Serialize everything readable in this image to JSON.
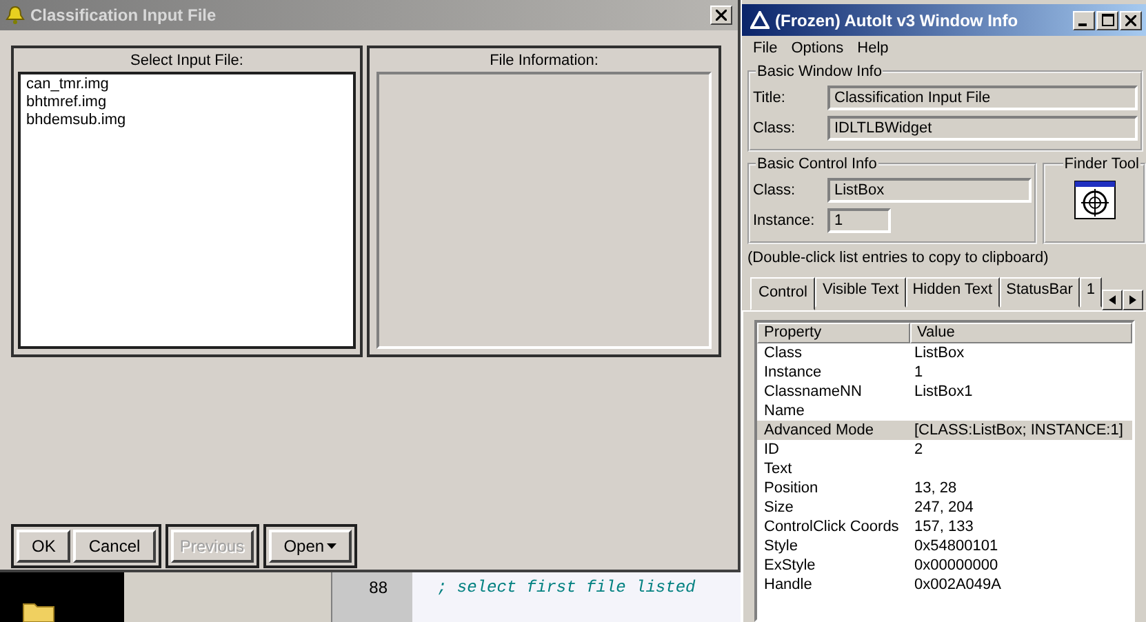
{
  "dialog": {
    "title": "Classification Input File",
    "select_panel": {
      "heading": "Select Input File:",
      "files": [
        {
          "name": "can_tmr.img",
          "selected": false
        },
        {
          "name": "bhtmref.img",
          "selected": false
        },
        {
          "name": "bhdemsub.img",
          "selected": false
        }
      ]
    },
    "info_panel": {
      "heading": "File Information:"
    },
    "button_groups": [
      [
        {
          "label": "OK",
          "disabled": false,
          "kind": "plain"
        },
        {
          "label": "Cancel",
          "disabled": false,
          "kind": "plain"
        }
      ],
      [
        {
          "label": "Previous",
          "disabled": true,
          "kind": "plain"
        }
      ],
      [
        {
          "label": "Open",
          "disabled": false,
          "kind": "menu"
        }
      ]
    ]
  },
  "editor": {
    "line_number": "88",
    "code": "; select first file listed"
  },
  "info_window": {
    "title": "(Frozen) AutoIt v3 Window Info",
    "menu": [
      "File",
      "Options",
      "Help"
    ],
    "window_info": {
      "heading": "Basic Window Info",
      "fields": [
        {
          "label": "Title:",
          "value": "Classification Input File"
        },
        {
          "label": "Class:",
          "value": "IDLTLBWidget"
        }
      ]
    },
    "control_info": {
      "heading": "Basic Control Info",
      "fields": [
        {
          "label": "Class:",
          "value": "ListBox"
        },
        {
          "label": "Instance:",
          "value": "1"
        }
      ]
    },
    "finder": {
      "heading": "Finder Tool"
    },
    "hint": "(Double-click list entries to copy to clipboard)",
    "tabs": [
      {
        "label": "Control",
        "selected": true
      },
      {
        "label": "Visible Text",
        "selected": false
      },
      {
        "label": "Hidden Text",
        "selected": false
      },
      {
        "label": "StatusBar",
        "selected": false
      },
      {
        "label": "1",
        "selected": false
      }
    ],
    "table": {
      "columns": [
        "Property",
        "Value"
      ],
      "rows": [
        {
          "property": "Class",
          "value": "ListBox",
          "selected": false
        },
        {
          "property": "Instance",
          "value": "1",
          "selected": false
        },
        {
          "property": "ClassnameNN",
          "value": "ListBox1",
          "selected": false
        },
        {
          "property": "Name",
          "value": "",
          "selected": false
        },
        {
          "property": "Advanced Mode",
          "value": "[CLASS:ListBox; INSTANCE:1]",
          "selected": true
        },
        {
          "property": "ID",
          "value": "2",
          "selected": false
        },
        {
          "property": "Text",
          "value": "",
          "selected": false
        },
        {
          "property": "Position",
          "value": "13, 28",
          "selected": false
        },
        {
          "property": "Size",
          "value": "247, 204",
          "selected": false
        },
        {
          "property": "ControlClick Coords",
          "value": "157, 133",
          "selected": false
        },
        {
          "property": "Style",
          "value": "0x54800101",
          "selected": false
        },
        {
          "property": "ExStyle",
          "value": "0x00000000",
          "selected": false
        },
        {
          "property": "Handle",
          "value": "0x002A049A",
          "selected": false
        }
      ]
    }
  }
}
